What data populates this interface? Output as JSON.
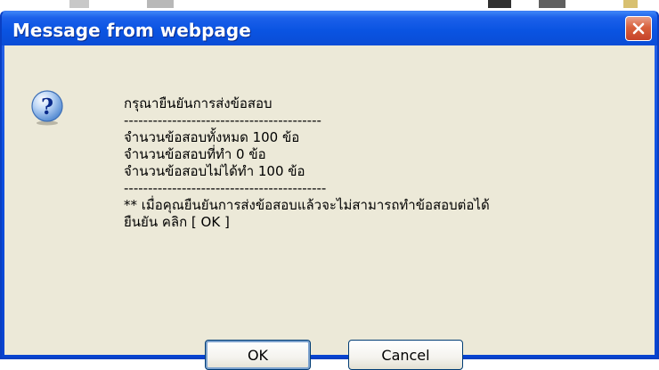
{
  "dialog": {
    "title": "Message from webpage",
    "icon": "question-icon",
    "message_lines": [
      "กรุณายืนยันการส่งข้อสอบ",
      "-----------------------------------------",
      "จำนวนข้อสอบทั้งหมด 100 ข้อ",
      "จำนวนข้อสอบที่ทำ 0 ข้อ",
      "จำนวนข้อสอบไม่ได้ทำ 100 ข้อ",
      "------------------------------------------",
      "** เมื่อคุณยืนยันการส่งข้อสอบแล้วจะไม่สามารถทำข้อสอบต่อได้",
      "ยืนยัน คลิก [ OK ]"
    ],
    "buttons": {
      "ok_label": "OK",
      "cancel_label": "Cancel"
    }
  },
  "colors": {
    "titlebar": "#0a54e2",
    "client_background": "#ece9d8",
    "close_button": "#d8613c"
  }
}
